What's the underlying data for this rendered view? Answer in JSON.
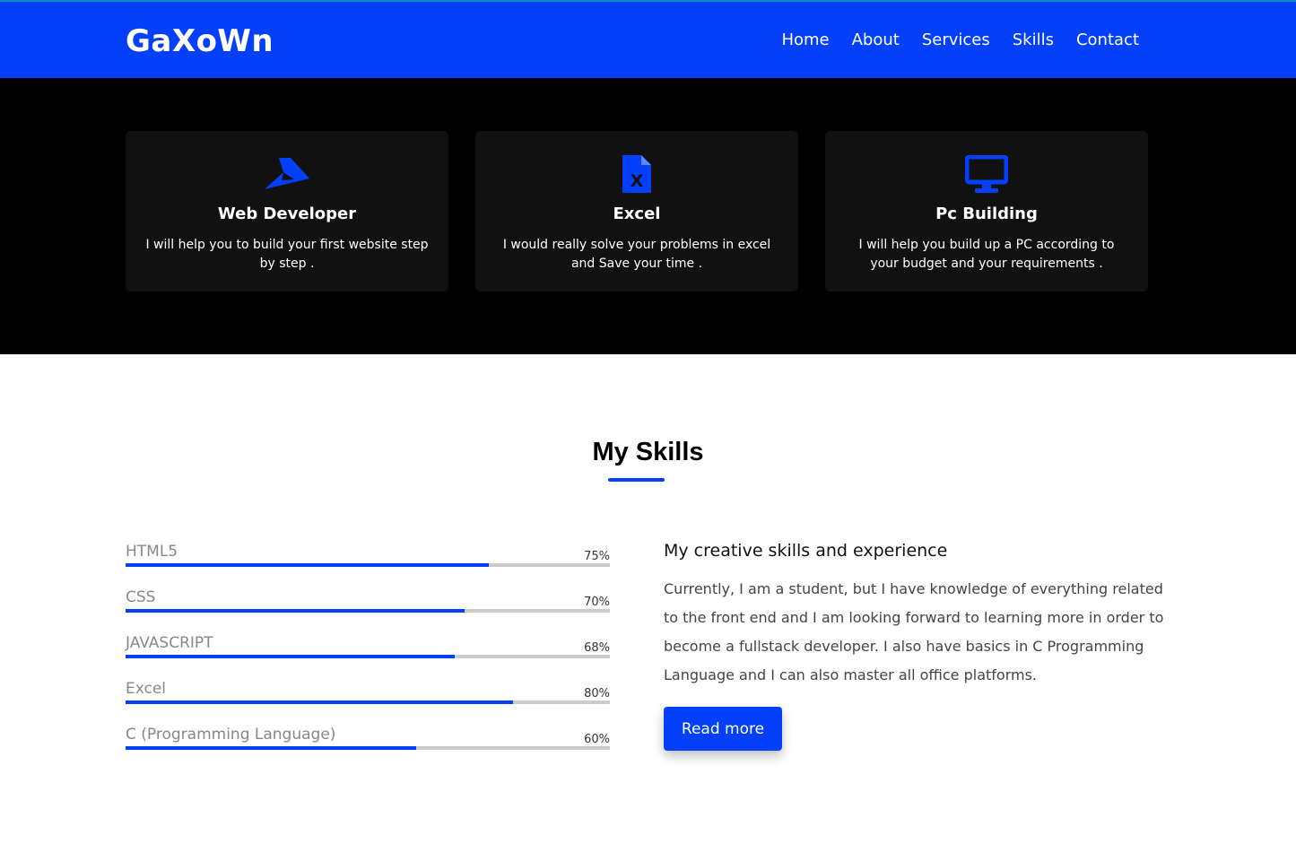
{
  "brand": {
    "logo": "GaXoWn",
    "accent": "#0440f9"
  },
  "nav": {
    "items": [
      {
        "label": "Home"
      },
      {
        "label": "About"
      },
      {
        "label": "Services"
      },
      {
        "label": "Skills"
      },
      {
        "label": "Contact"
      }
    ]
  },
  "services": [
    {
      "icon": "paper-plane-icon",
      "title": "Web Developer",
      "description": "I will help you to build your first website step by step ."
    },
    {
      "icon": "excel-file-icon",
      "title": "Excel",
      "description": "I would really solve your problems in excel and Save your time ."
    },
    {
      "icon": "desktop-monitor-icon",
      "title": "Pc Building",
      "description": "I will help you build up a PC according to your budget and your requirements ."
    }
  ],
  "skills": {
    "title": "My Skills",
    "bars": [
      {
        "name": "HTML5",
        "percent_label": "75%",
        "value": 75
      },
      {
        "name": "CSS",
        "percent_label": "70%",
        "value": 70
      },
      {
        "name": "JAVASCRIPT",
        "percent_label": "68%",
        "value": 68
      },
      {
        "name": "Excel",
        "percent_label": "80%",
        "value": 80
      },
      {
        "name": "C (Programming Language)",
        "percent_label": "60%",
        "value": 60
      }
    ],
    "about_heading": "My creative skills and experience",
    "about_text": "Currently, I am a student, but I have knowledge of everything related to the front end and I am looking forward to learning more in order to become a fullstack developer. I also have basics in C Programming Language and I can also master all office platforms.",
    "button_label": "Read more"
  }
}
